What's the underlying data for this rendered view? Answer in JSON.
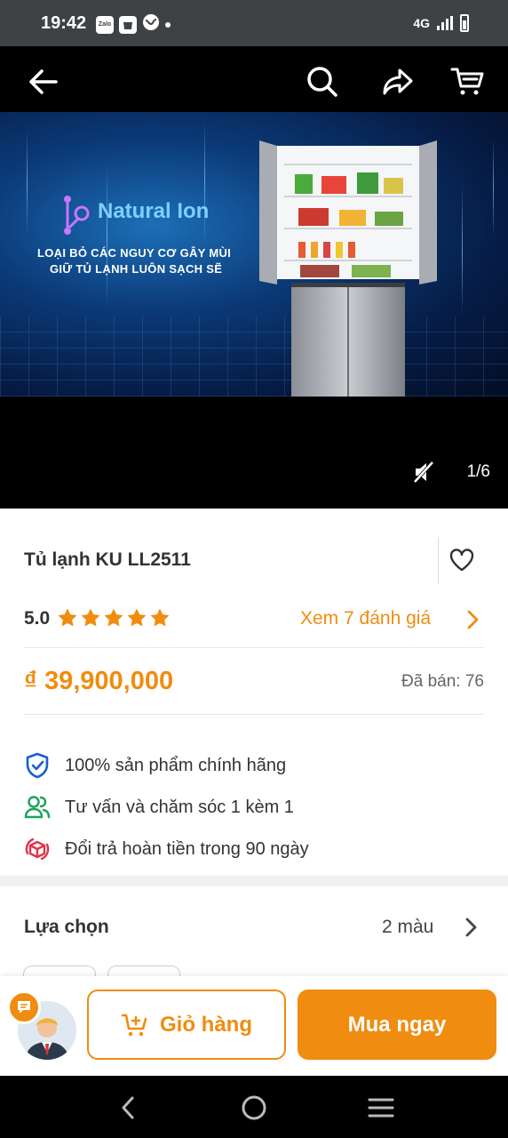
{
  "status_bar": {
    "time": "19:42",
    "app_icon_label": "Zalo",
    "network": "4G"
  },
  "header": {
    "back_icon": "arrow-left-icon",
    "search_icon": "search-icon",
    "share_icon": "share-icon",
    "cart_icon": "cart-icon"
  },
  "hero": {
    "brand_title": "Natural Ion",
    "line1": "LOẠI BỎ CÁC NGUY CƠ GÂY MÙI",
    "line2": "GIỮ TỦ LẠNH LUÔN SẠCH SẼ",
    "counter": "1/6"
  },
  "product": {
    "title": "Tủ lạnh KU LL2511",
    "rating": "5.0",
    "stars": 5,
    "reviews_link": "Xem 7 đánh giá",
    "price": "₫ 39,900,000",
    "sold": "Đã bán: 76"
  },
  "benefits": [
    {
      "icon": "shield-check-icon",
      "text": "100% sản phẩm chính hãng"
    },
    {
      "icon": "users-icon",
      "text": "Tư vấn và chăm sóc 1 kèm 1"
    },
    {
      "icon": "return-box-icon",
      "text": "Đổi trả hoàn tiền trong 90 ngày"
    }
  ],
  "options": {
    "title": "Lựa chọn",
    "count": "2 màu"
  },
  "actions": {
    "cart_label": "Giỏ hàng",
    "buy_label": "Mua ngay"
  },
  "colors": {
    "accent": "#f08c0f",
    "primary_blue": "#1a5fd0",
    "green": "#1fa35c",
    "red": "#e0344a"
  }
}
